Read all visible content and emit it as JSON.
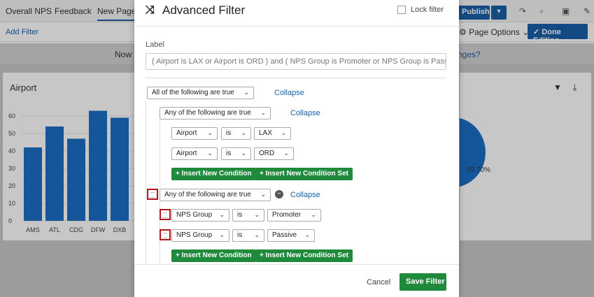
{
  "app": {
    "tabs": [
      "Overall NPS",
      "Feedback",
      "New Page"
    ],
    "publish_label": "Publish",
    "add_filter": "Add Filter",
    "page_options": "Page Options",
    "done_editing": "Done Editing",
    "banner_left": "Now",
    "banner_right": "nges?",
    "widget_title": "Airport",
    "pie_label": "59.70%",
    "accent": "#1a5fa8"
  },
  "chart_data": {
    "type": "bar",
    "categories": [
      "AMS",
      "ATL",
      "CDG",
      "DFW",
      "DXB"
    ],
    "values": [
      42,
      54,
      47,
      63,
      59
    ],
    "title": "Airport",
    "ylim": [
      0,
      60
    ],
    "yticks": [
      0,
      10,
      20,
      30,
      40,
      50,
      60
    ],
    "color": "#1a6fc4"
  },
  "modal": {
    "title": "Advanced Filter",
    "lock_label": "Lock filter",
    "label_heading": "Label",
    "label_value": "( Airport is LAX or Airport is ORD ) and ( NPS Group is Promoter or NPS Group is Passiv...",
    "root_group": "All of the following are true",
    "collapse": "Collapse",
    "group1": {
      "header": "Any of the following are true",
      "conditions": [
        {
          "field": "Airport",
          "op": "is",
          "value": "LAX"
        },
        {
          "field": "Airport",
          "op": "is",
          "value": "ORD"
        }
      ]
    },
    "group2": {
      "header": "Any of the following are true",
      "conditions": [
        {
          "field": "NPS Group",
          "op": "is",
          "value": "Promoter"
        },
        {
          "field": "NPS Group",
          "op": "is",
          "value": "Passive"
        }
      ]
    },
    "insert_condition": "Insert New Condition",
    "insert_condition_set": "Insert New Condition Set",
    "cancel": "Cancel",
    "save": "Save Filter",
    "green": "#1f8a3c"
  }
}
